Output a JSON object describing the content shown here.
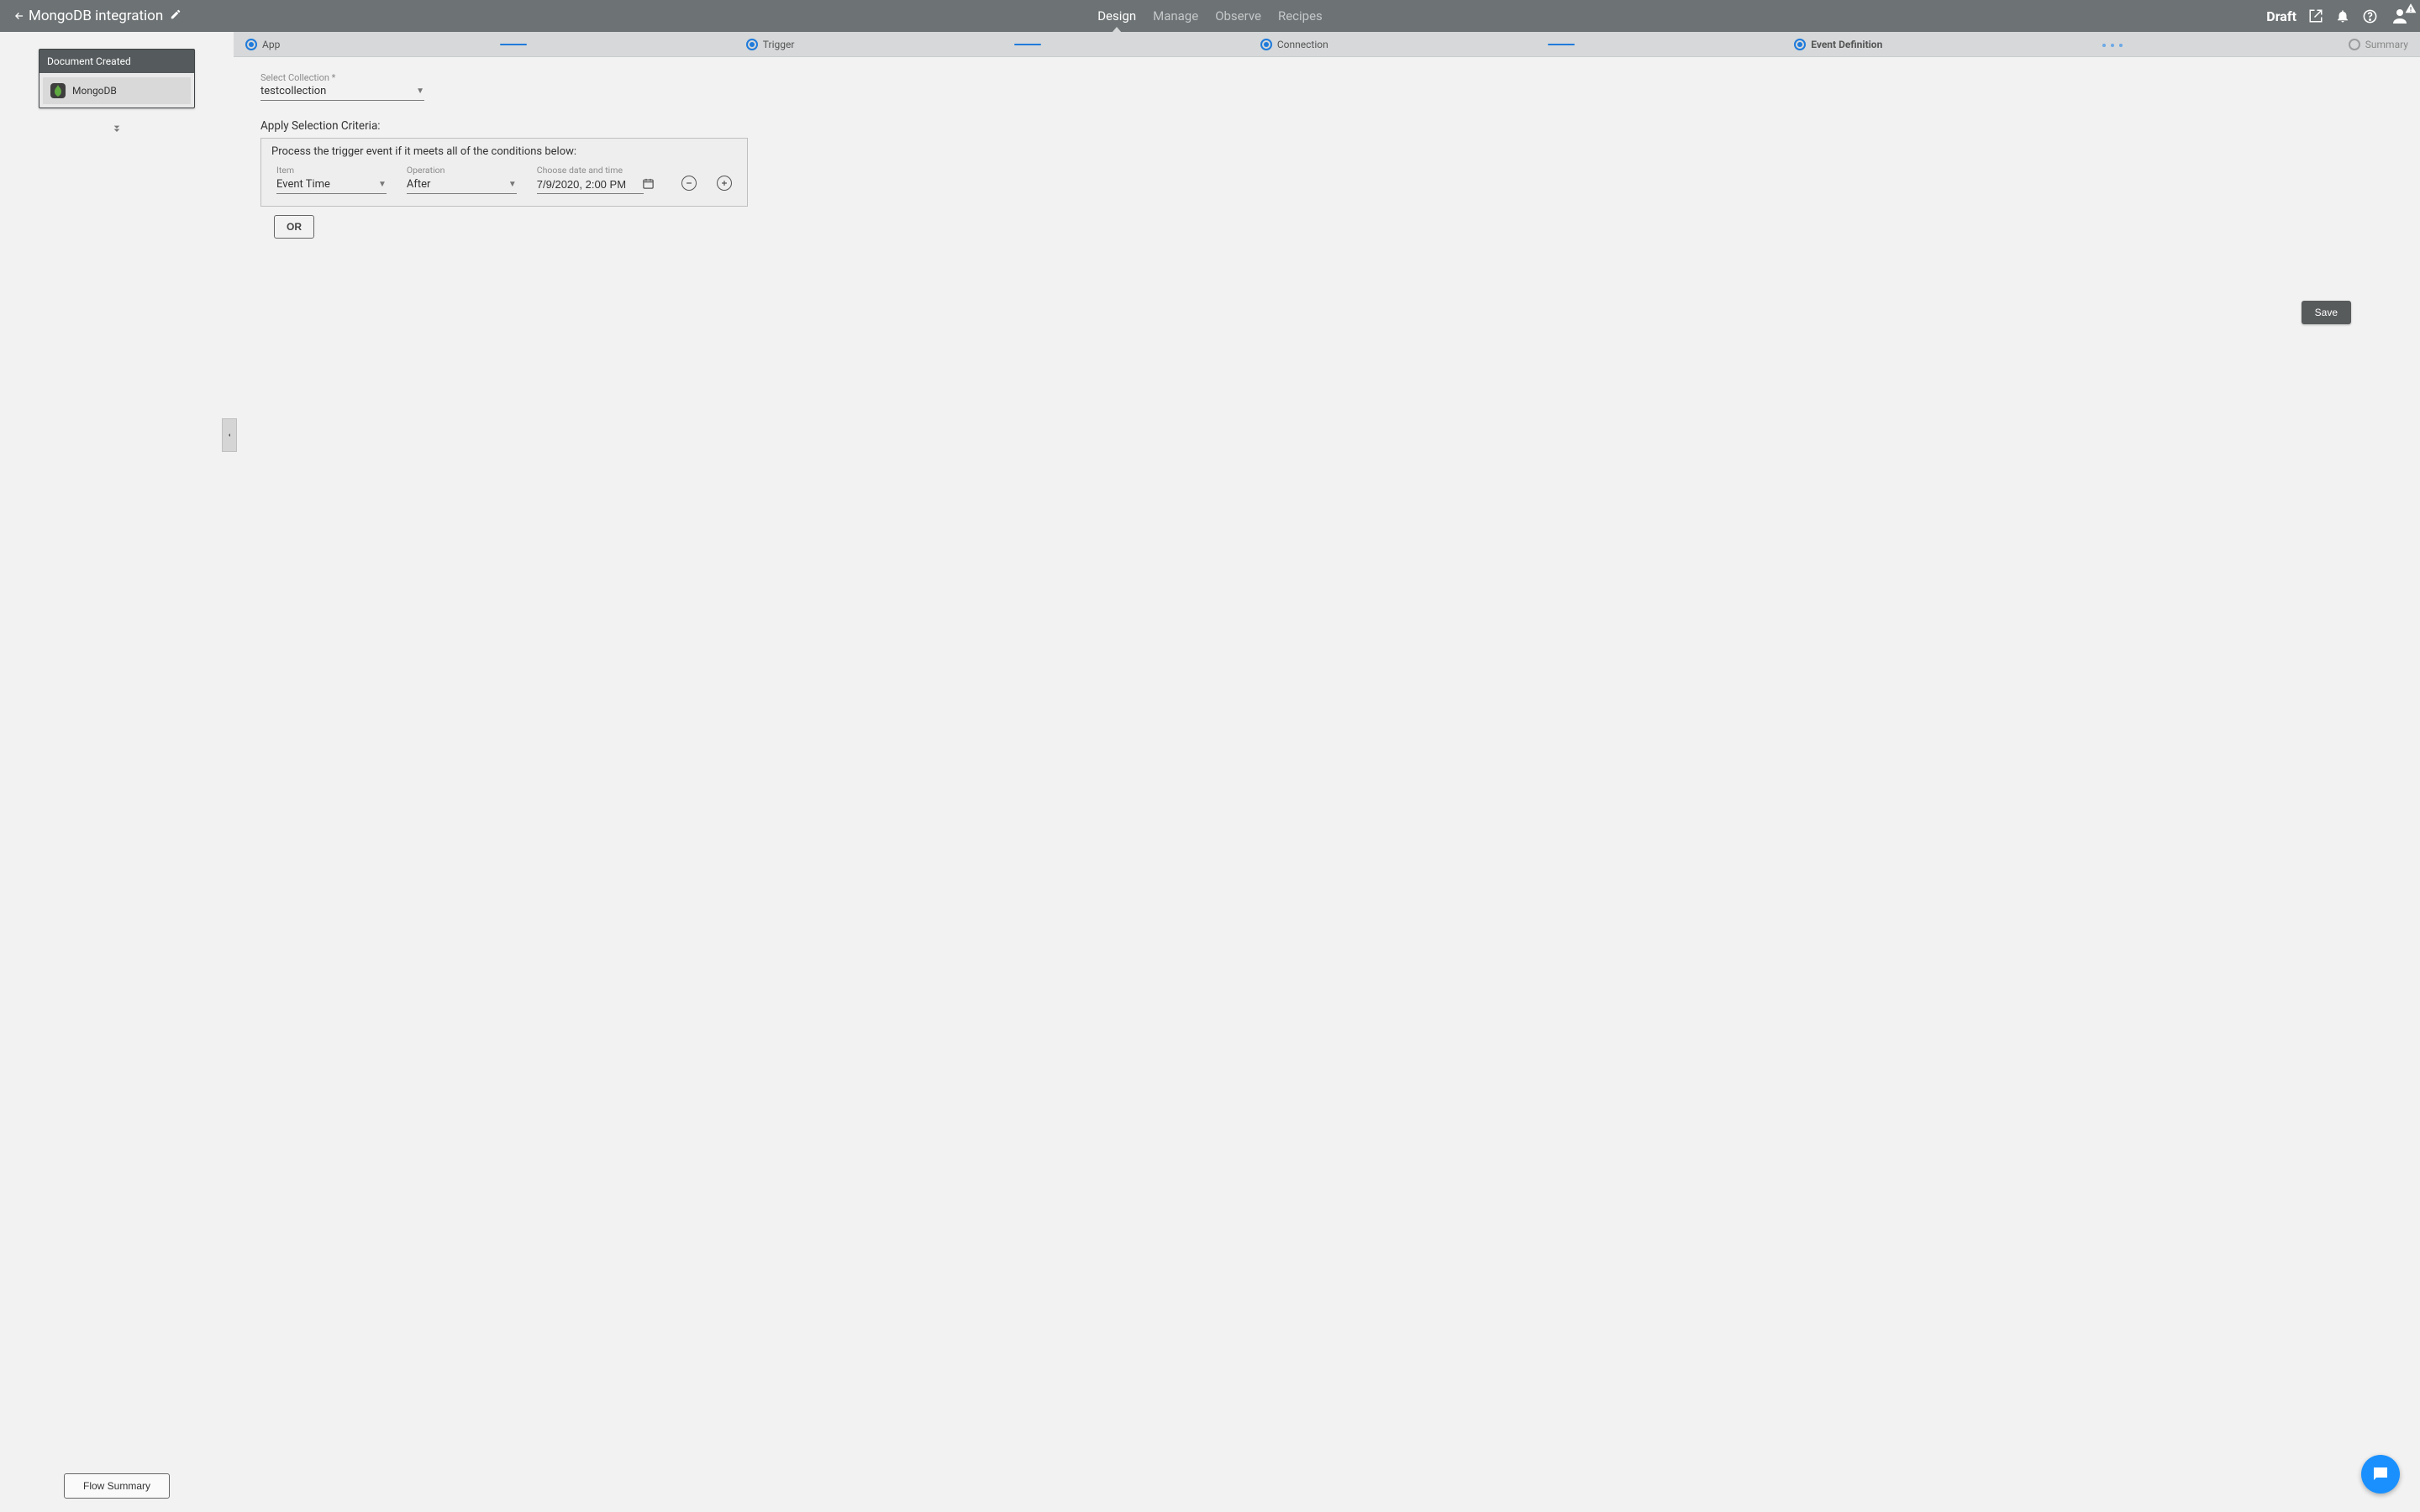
{
  "header": {
    "title": "MongoDB integration",
    "nav": {
      "design": "Design",
      "manage": "Manage",
      "observe": "Observe",
      "recipes": "Recipes"
    },
    "status": "Draft"
  },
  "sidebar": {
    "card_title": "Document Created",
    "tile_label": "MongoDB",
    "flow_summary": "Flow Summary"
  },
  "stepper": {
    "app": "App",
    "trigger": "Trigger",
    "connection": "Connection",
    "event_definition": "Event Definition",
    "summary": "Summary"
  },
  "form": {
    "select_collection_label": "Select Collection *",
    "select_collection_value": "testcollection",
    "criteria_title": "Apply Selection Criteria:",
    "criteria_intro": "Process the trigger event if it meets all of the conditions below:",
    "item_label": "Item",
    "item_value": "Event Time",
    "operation_label": "Operation",
    "operation_value": "After",
    "date_label": "Choose date and time",
    "date_value": "7/9/2020, 2:00 PM",
    "or_label": "OR",
    "save_label": "Save"
  }
}
